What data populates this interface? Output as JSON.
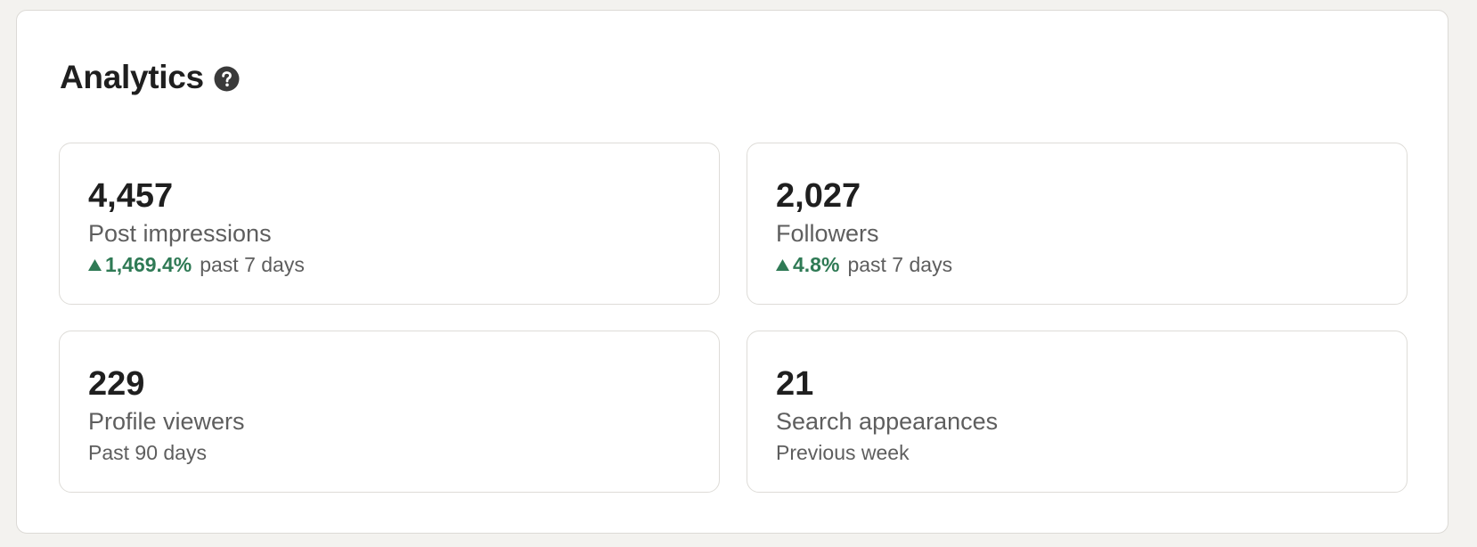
{
  "analytics": {
    "title": "Analytics",
    "help_icon": "question-circle-icon",
    "trend_icon": "triangle-up-icon",
    "colors": {
      "background": "#f3f2ef",
      "panel": "#ffffff",
      "trend_positive": "#2f7a55",
      "text_primary": "#1f1f1f",
      "text_secondary": "#5e5e5e"
    },
    "cards": [
      {
        "value": "4,457",
        "label": "Post impressions",
        "trend": "1,469.4%",
        "period": "past 7 days"
      },
      {
        "value": "2,027",
        "label": "Followers",
        "trend": "4.8%",
        "period": "past 7 days"
      },
      {
        "value": "229",
        "label": "Profile viewers",
        "period": "Past 90 days"
      },
      {
        "value": "21",
        "label": "Search appearances",
        "period": "Previous week"
      }
    ]
  }
}
